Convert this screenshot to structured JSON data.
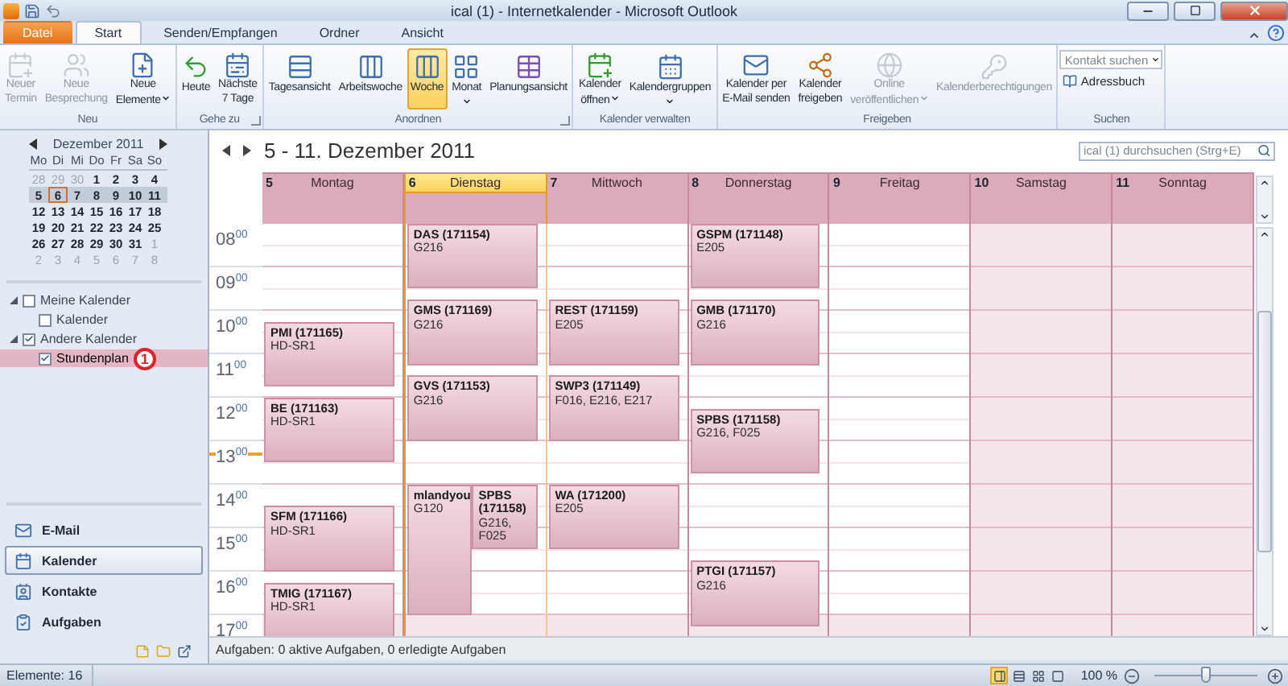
{
  "window": {
    "title": "ical (1) - Internetkalender - Microsoft Outlook"
  },
  "ribbon_tabs": [
    {
      "label": "Datei",
      "kind": "file",
      "selected": false
    },
    {
      "label": "Start",
      "kind": "tab",
      "selected": true
    },
    {
      "label": "Senden/Empfangen",
      "kind": "tab",
      "selected": false
    },
    {
      "label": "Ordner",
      "kind": "tab",
      "selected": false
    },
    {
      "label": "Ansicht",
      "kind": "tab",
      "selected": false
    }
  ],
  "ribbon_groups": [
    {
      "label": "Neu",
      "kind": "buttons",
      "launcher": false,
      "buttons": [
        {
          "lines": [
            "Neuer",
            "Termin"
          ],
          "disabled": true,
          "dropdown": false
        },
        {
          "lines": [
            "Neue",
            "Besprechung"
          ],
          "disabled": true,
          "dropdown": false
        },
        {
          "lines": [
            "Neue",
            "Elemente"
          ],
          "disabled": false,
          "dropdown": true
        }
      ]
    },
    {
      "label": "Gehe zu",
      "kind": "buttons",
      "launcher": true,
      "buttons": [
        {
          "lines": [
            "Heute"
          ],
          "disabled": false,
          "dropdown": false
        },
        {
          "lines": [
            "Nächste",
            "7 Tage"
          ],
          "disabled": false,
          "dropdown": false
        }
      ]
    },
    {
      "label": "Anordnen",
      "kind": "buttons",
      "launcher": true,
      "buttons": [
        {
          "lines": [
            "Tagesansicht"
          ],
          "disabled": false,
          "dropdown": false,
          "selected": false
        },
        {
          "lines": [
            "Arbeitswoche"
          ],
          "disabled": false,
          "dropdown": false,
          "selected": false
        },
        {
          "lines": [
            "Woche"
          ],
          "disabled": false,
          "dropdown": false,
          "selected": true
        },
        {
          "lines": [
            "Monat"
          ],
          "disabled": false,
          "dropdown": true,
          "selected": false
        },
        {
          "lines": [
            "Planungsansicht"
          ],
          "disabled": false,
          "dropdown": false,
          "selected": false
        }
      ]
    },
    {
      "label": "Kalender verwalten",
      "kind": "buttons",
      "launcher": false,
      "buttons": [
        {
          "lines": [
            "Kalender",
            "öffnen"
          ],
          "disabled": false,
          "dropdown": true
        },
        {
          "lines": [
            "Kalendergruppen"
          ],
          "disabled": false,
          "dropdown": true
        }
      ]
    },
    {
      "label": "Freigeben",
      "kind": "buttons",
      "launcher": false,
      "buttons": [
        {
          "lines": [
            "Kalender per",
            "E-Mail senden"
          ],
          "disabled": false,
          "dropdown": false
        },
        {
          "lines": [
            "Kalender",
            "freigeben"
          ],
          "disabled": false,
          "dropdown": false
        },
        {
          "lines": [
            "Online",
            "veröffentlichen"
          ],
          "disabled": true,
          "dropdown": true
        },
        {
          "lines": [
            "Kalenderberechtigungen"
          ],
          "disabled": true,
          "dropdown": false
        }
      ]
    },
    {
      "label": "Suchen",
      "kind": "search",
      "launcher": false,
      "field": {
        "placeholder": "Kontakt suchen"
      },
      "buttons": [
        {
          "lines": [
            "Adressbuch"
          ],
          "disabled": false,
          "dropdown": false
        }
      ]
    }
  ],
  "mini_calendar": {
    "month": "Dezember 2011",
    "weekdays": [
      "Mo",
      "Di",
      "Mi",
      "Do",
      "Fr",
      "Sa",
      "So"
    ],
    "weeks": [
      {
        "selected": false,
        "days": [
          {
            "d": "28",
            "muted": true,
            "today": false
          },
          {
            "d": "29",
            "muted": true,
            "today": false
          },
          {
            "d": "30",
            "muted": true,
            "today": false
          },
          {
            "d": "1",
            "muted": false,
            "today": false
          },
          {
            "d": "2",
            "muted": false,
            "today": false
          },
          {
            "d": "3",
            "muted": false,
            "today": false
          },
          {
            "d": "4",
            "muted": false,
            "today": false
          }
        ]
      },
      {
        "selected": true,
        "days": [
          {
            "d": "5",
            "muted": false,
            "today": false
          },
          {
            "d": "6",
            "muted": false,
            "today": true
          },
          {
            "d": "7",
            "muted": false,
            "today": false
          },
          {
            "d": "8",
            "muted": false,
            "today": false
          },
          {
            "d": "9",
            "muted": false,
            "today": false
          },
          {
            "d": "10",
            "muted": false,
            "today": false
          },
          {
            "d": "11",
            "muted": false,
            "today": false
          }
        ]
      },
      {
        "selected": false,
        "days": [
          {
            "d": "12",
            "muted": false,
            "today": false
          },
          {
            "d": "13",
            "muted": false,
            "today": false
          },
          {
            "d": "14",
            "muted": false,
            "today": false
          },
          {
            "d": "15",
            "muted": false,
            "today": false
          },
          {
            "d": "16",
            "muted": false,
            "today": false
          },
          {
            "d": "17",
            "muted": false,
            "today": false
          },
          {
            "d": "18",
            "muted": false,
            "today": false
          }
        ]
      },
      {
        "selected": false,
        "days": [
          {
            "d": "19",
            "muted": false,
            "today": false
          },
          {
            "d": "20",
            "muted": false,
            "today": false
          },
          {
            "d": "21",
            "muted": false,
            "today": false
          },
          {
            "d": "22",
            "muted": false,
            "today": false
          },
          {
            "d": "23",
            "muted": false,
            "today": false
          },
          {
            "d": "24",
            "muted": false,
            "today": false
          },
          {
            "d": "25",
            "muted": false,
            "today": false
          }
        ]
      },
      {
        "selected": false,
        "days": [
          {
            "d": "26",
            "muted": false,
            "today": false
          },
          {
            "d": "27",
            "muted": false,
            "today": false
          },
          {
            "d": "28",
            "muted": false,
            "today": false
          },
          {
            "d": "29",
            "muted": false,
            "today": false
          },
          {
            "d": "30",
            "muted": false,
            "today": false
          },
          {
            "d": "31",
            "muted": false,
            "today": false
          },
          {
            "d": "1",
            "muted": true,
            "today": false
          }
        ]
      },
      {
        "selected": false,
        "days": [
          {
            "d": "2",
            "muted": true,
            "today": false
          },
          {
            "d": "3",
            "muted": true,
            "today": false
          },
          {
            "d": "4",
            "muted": true,
            "today": false
          },
          {
            "d": "5",
            "muted": true,
            "today": false
          },
          {
            "d": "6",
            "muted": true,
            "today": false
          },
          {
            "d": "7",
            "muted": true,
            "today": false
          },
          {
            "d": "8",
            "muted": true,
            "today": false
          }
        ]
      }
    ]
  },
  "calendars": [
    {
      "label": "Meine Kalender",
      "checked": false,
      "expanded": true,
      "selected": false,
      "children": [
        {
          "label": "Kalender",
          "checked": false,
          "selected": false
        }
      ]
    },
    {
      "label": "Andere Kalender",
      "checked": true,
      "expanded": true,
      "selected": false,
      "children": [
        {
          "label": "Stundenplan",
          "checked": true,
          "selected": true,
          "annotation": "1"
        }
      ]
    }
  ],
  "navigation": [
    {
      "label": "E-Mail",
      "selected": false
    },
    {
      "label": "Kalender",
      "selected": true
    },
    {
      "label": "Kontakte",
      "selected": false
    },
    {
      "label": "Aufgaben",
      "selected": false
    }
  ],
  "calendar": {
    "title": "5 - 11. Dezember 2011",
    "search": {
      "placeholder": "ical (1) durchsuchen (Strg+E)"
    },
    "hours": [
      "08$^{00}$",
      "09$^{00}$",
      "10$^{00}$",
      "11$^{00}$",
      "12$^{00}$",
      "13$^{00}$",
      "14$^{00}$",
      "15$^{00}$",
      "16$^{00}$",
      "17$^{00}$"
    ],
    "days": [
      {
        "number": "5",
        "name": "Montag",
        "today": false,
        "weekend": false,
        "events": [
          {
            "title": "PMI (171165)",
            "location": "HD-SR1"
          },
          {
            "title": "BE (171163)",
            "location": "HD-SR1"
          },
          {
            "title": "SFM (171166)",
            "location": "HD-SR1"
          },
          {
            "title": "TMIG (171167)",
            "location": "HD-SR1"
          }
        ]
      },
      {
        "number": "6",
        "name": "Dienstag",
        "today": true,
        "weekend": false,
        "events": [
          {
            "title": "DAS (171154)",
            "location": "G216"
          },
          {
            "title": "GMS (171169)",
            "location": "G216"
          },
          {
            "title": "GVS (171153)",
            "location": "G216"
          },
          {
            "title": "mlandyou",
            "location": "G120"
          },
          {
            "title": "SPBS (171158)",
            "location": "G216, F025"
          }
        ]
      },
      {
        "number": "7",
        "name": "Mittwoch",
        "today": false,
        "weekend": false,
        "events": [
          {
            "title": "REST (171159)",
            "location": "E205"
          },
          {
            "title": "SWP3 (171149)",
            "location": "F016, E216, E217"
          },
          {
            "title": "WA (171200)",
            "location": "E205"
          }
        ]
      },
      {
        "number": "8",
        "name": "Donnerstag",
        "today": false,
        "weekend": false,
        "events": [
          {
            "title": "GSPM (171148)",
            "location": "E205"
          },
          {
            "title": "GMB (171170)",
            "location": "G216"
          },
          {
            "title": "SPBS (171158)",
            "location": "G216, F025"
          },
          {
            "title": "PTGI (171157)",
            "location": "G216"
          }
        ]
      },
      {
        "number": "9",
        "name": "Freitag",
        "today": false,
        "weekend": false
      },
      {
        "number": "10",
        "name": "Samstag",
        "today": false,
        "weekend": true
      },
      {
        "number": "11",
        "name": "Sonntag",
        "today": false,
        "weekend": true
      }
    ],
    "task_bar": "Aufgaben: 0 aktive Aufgaben, 0 erledigte Aufgaben"
  },
  "status_bar": {
    "items": "Elemente: 16",
    "views": [
      {
        "selected": true
      },
      {
        "selected": false
      },
      {
        "selected": false
      },
      {
        "selected": false
      }
    ],
    "zoom": "100 %",
    "zoom_slider": {
      "level": 0.5
    }
  }
}
